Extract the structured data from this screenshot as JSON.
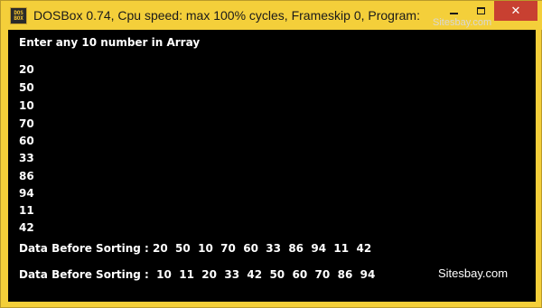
{
  "window": {
    "title": "DOSBox 0.74, Cpu speed: max 100% cycles, Frameskip 0, Program:",
    "watermark": "Sitesbay.com",
    "icon": "dosbox-icon",
    "icon_lines": [
      "DOS",
      "BOX"
    ],
    "controls": {
      "minimize_icon": "minimize-icon",
      "maximize_icon": "maximize-icon",
      "close_icon": "close-icon",
      "close_glyph": "✕",
      "close_color": "#c84031"
    },
    "frame_color": "#f4cf3a"
  },
  "console": {
    "background": "#000000",
    "text_color": "#ffffff",
    "prompt": "Enter any 10 number in Array",
    "inputs": [
      "20",
      "50",
      "10",
      "70",
      "60",
      "33",
      "86",
      "94",
      "11",
      "42"
    ],
    "before_line": "Data Before Sorting : 20  50  10  70  60  33  86  94  11  42",
    "after_line": "Data Before Sorting :  10  11  20  33  42  50  60  70  86  94",
    "brand": "Sitesbay.com"
  }
}
